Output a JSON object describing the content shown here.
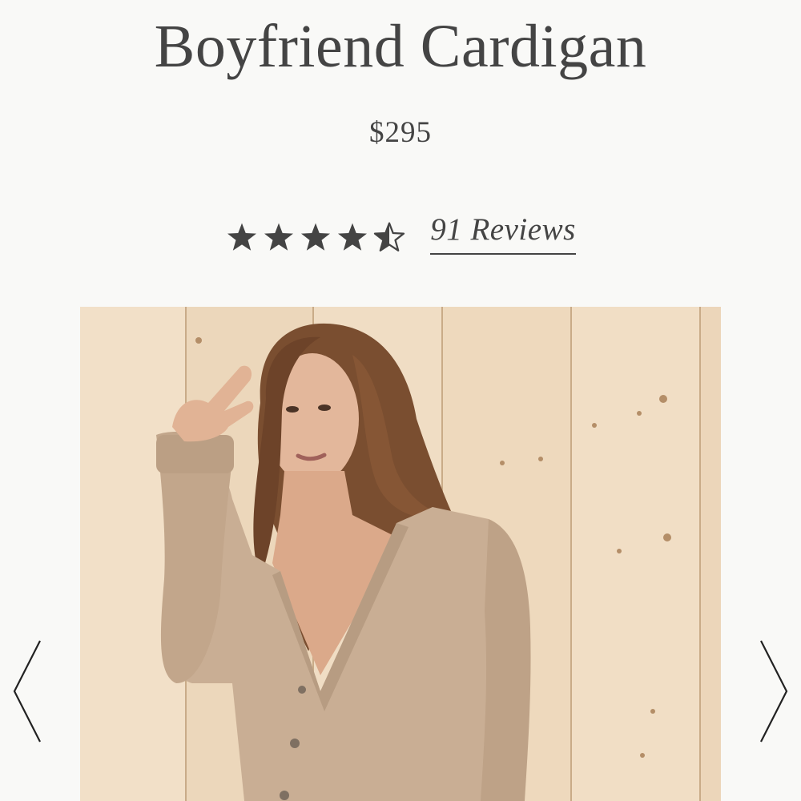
{
  "product": {
    "title": "Boyfriend Cardigan",
    "price": "$295",
    "rating": 4.5,
    "rating_max": 5,
    "reviews_label": "91 Reviews",
    "image_icon": "product-photo"
  },
  "carousel": {
    "prev_icon": "chevron-left-icon",
    "next_icon": "chevron-right-icon"
  },
  "colors": {
    "text": "#444444",
    "background": "#f9f9f7",
    "star": "#444444"
  }
}
